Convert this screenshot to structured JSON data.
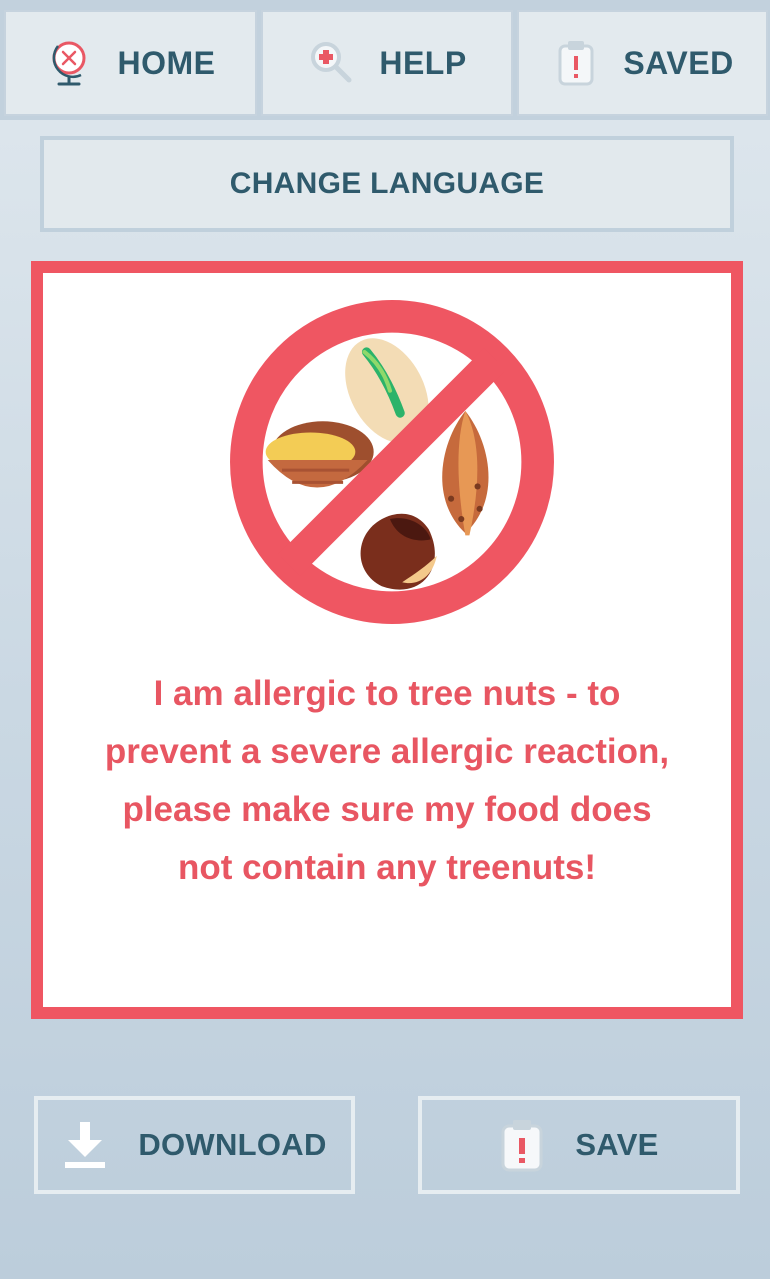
{
  "nav": {
    "home_label": "HOME",
    "help_label": "HELP",
    "saved_label": "SAVED"
  },
  "language": {
    "button_label": "CHANGE LANGUAGE"
  },
  "card": {
    "message": "I am allergic to tree nuts - to prevent a severe allergic reaction, please make sure my food does not contain any treenuts!",
    "border_color": "#ef5662",
    "text_color": "#e85662"
  },
  "actions": {
    "download_label": "DOWNLOAD",
    "save_label": "SAVE"
  },
  "icons": {
    "home": "globe-fork-spoon-icon",
    "help": "magnifier-medical-cross-icon",
    "saved": "clipboard-alert-icon",
    "download": "download-arrow-icon",
    "save": "clipboard-alert-icon",
    "allergen": "no-tree-nuts-icon"
  },
  "colors": {
    "brand_text": "#2f5a6c",
    "accent_red": "#ef5662"
  }
}
